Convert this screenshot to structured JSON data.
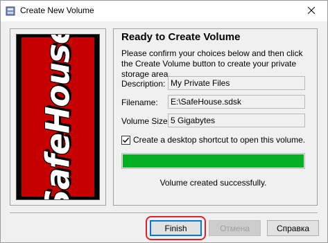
{
  "window": {
    "title": "Create New Volume",
    "icons": {
      "app": "safehouse-app-icon",
      "close": "close-icon"
    }
  },
  "banner": {
    "logo_text": "SafeHouse"
  },
  "panel": {
    "heading": "Ready to Create Volume",
    "instructions": "Please confirm your choices below and then click the Create Volume button to create your private storage area.",
    "fields": [
      {
        "label": "Description:",
        "value": "My Private Files"
      },
      {
        "label": "Filename:",
        "value": "E:\\SafeHouse.sdsk"
      },
      {
        "label": "Volume Size:",
        "value": "5 Gigabytes"
      }
    ],
    "shortcut_checkbox": {
      "label": "Create a desktop shortcut to open this volume.",
      "checked": true
    },
    "progress": {
      "value": 1.0,
      "color": "#06b025"
    },
    "status": "Volume created successfully."
  },
  "buttons": {
    "finish": "Finish",
    "cancel": "Отмена",
    "help": "Справка"
  },
  "colors": {
    "highlight": "#e0202c",
    "banner_red": "#c60000"
  }
}
